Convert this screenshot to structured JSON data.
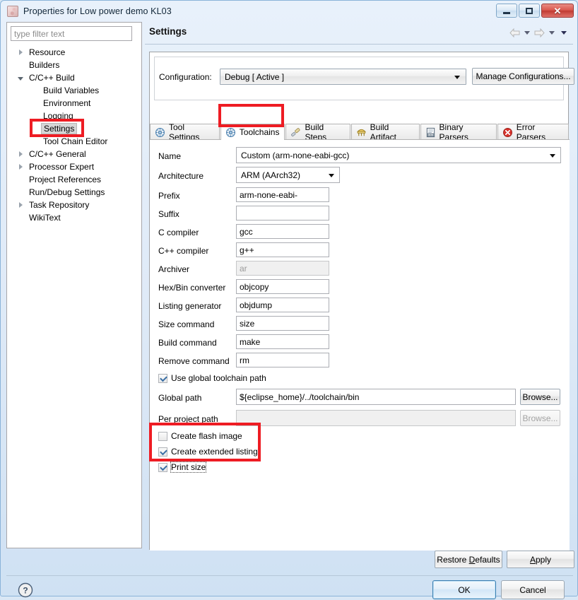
{
  "window": {
    "title": "Properties for Low power demo KL03",
    "icon": "eclipse-project-icon",
    "minimize_label": "Minimize",
    "maximize_label": "Maximize",
    "close_label": "Close"
  },
  "sidebar": {
    "filter_placeholder": "type filter text",
    "filter_value": "",
    "items": [
      {
        "label": "Resource",
        "indent": 0,
        "twisty": "collapsed",
        "selected": false
      },
      {
        "label": "Builders",
        "indent": 0,
        "twisty": "none",
        "selected": false
      },
      {
        "label": "C/C++ Build",
        "indent": 0,
        "twisty": "expanded",
        "selected": false
      },
      {
        "label": "Build Variables",
        "indent": 1,
        "twisty": "none",
        "selected": false
      },
      {
        "label": "Environment",
        "indent": 1,
        "twisty": "none",
        "selected": false
      },
      {
        "label": "Logging",
        "indent": 1,
        "twisty": "none",
        "selected": false
      },
      {
        "label": "Settings",
        "indent": 1,
        "twisty": "none",
        "selected": true
      },
      {
        "label": "Tool Chain Editor",
        "indent": 1,
        "twisty": "none",
        "selected": false
      },
      {
        "label": "C/C++ General",
        "indent": 0,
        "twisty": "collapsed",
        "selected": false
      },
      {
        "label": "Processor Expert",
        "indent": 0,
        "twisty": "collapsed",
        "selected": false
      },
      {
        "label": "Project References",
        "indent": 0,
        "twisty": "none",
        "selected": false
      },
      {
        "label": "Run/Debug Settings",
        "indent": 0,
        "twisty": "none",
        "selected": false
      },
      {
        "label": "Task Repository",
        "indent": 0,
        "twisty": "collapsed",
        "selected": false
      },
      {
        "label": "WikiText",
        "indent": 0,
        "twisty": "none",
        "selected": false
      }
    ]
  },
  "page": {
    "title": "Settings",
    "nav_back": "back-arrow",
    "nav_forward": "forward-arrow"
  },
  "configuration": {
    "label": "Configuration:",
    "value": "Debug  [ Active ]",
    "manage_button": "Manage Configurations..."
  },
  "tabs": [
    {
      "label": "Tool Settings",
      "icon": "tool-settings-icon",
      "active": false
    },
    {
      "label": "Toolchains",
      "icon": "toolchains-icon",
      "active": true
    },
    {
      "label": "Build Steps",
      "icon": "build-steps-icon",
      "active": false
    },
    {
      "label": "Build Artifact",
      "icon": "build-artifact-icon",
      "active": false
    },
    {
      "label": "Binary Parsers",
      "icon": "binary-parsers-icon",
      "active": false
    },
    {
      "label": "Error Parsers",
      "icon": "error-parsers-icon",
      "active": false
    }
  ],
  "form": {
    "name": {
      "label": "Name",
      "value": "Custom (arm-none-eabi-gcc)",
      "type": "dropdown"
    },
    "architecture": {
      "label": "Architecture",
      "value": "ARM (AArch32)",
      "type": "dropdown"
    },
    "prefix": {
      "label": "Prefix",
      "value": "arm-none-eabi-",
      "type": "text"
    },
    "suffix": {
      "label": "Suffix",
      "value": "",
      "type": "text"
    },
    "c_compiler": {
      "label": "C compiler",
      "value": "gcc",
      "type": "text"
    },
    "cpp_compiler": {
      "label": "C++ compiler",
      "value": "g++",
      "type": "text"
    },
    "archiver": {
      "label": "Archiver",
      "value": "ar",
      "type": "text",
      "disabled": true
    },
    "hexbin": {
      "label": "Hex/Bin converter",
      "value": "objcopy",
      "type": "text"
    },
    "listing": {
      "label": "Listing generator",
      "value": "objdump",
      "type": "text"
    },
    "size": {
      "label": "Size command",
      "value": "size",
      "type": "text"
    },
    "build": {
      "label": "Build command",
      "value": "make",
      "type": "text"
    },
    "remove": {
      "label": "Remove command",
      "value": "rm",
      "type": "text"
    },
    "use_global": {
      "label": "Use global toolchain path",
      "checked": true
    },
    "global_path": {
      "label": "Global path",
      "value": "${eclipse_home}/../toolchain/bin",
      "browse": "Browse..."
    },
    "project_path": {
      "label": "Per project path",
      "value": "",
      "browse": "Browse...",
      "disabled": true
    },
    "flash_image": {
      "label": "Create flash image",
      "checked": false
    },
    "ext_listing": {
      "label": "Create extended listing",
      "checked": true
    },
    "print_size": {
      "label": "Print size",
      "checked": true,
      "focused": true
    }
  },
  "buttons": {
    "restore_defaults": "Restore Defaults",
    "restore_defaults_mnemonic": "D",
    "apply": "Apply",
    "apply_mnemonic": "A",
    "ok": "OK",
    "cancel": "Cancel",
    "help": "help-icon"
  },
  "annotations": {
    "color": "#ee1c23",
    "boxes": [
      {
        "name": "settings-tree-item-highlight"
      },
      {
        "name": "toolchains-tab-highlight"
      },
      {
        "name": "listing-options-highlight"
      }
    ]
  }
}
